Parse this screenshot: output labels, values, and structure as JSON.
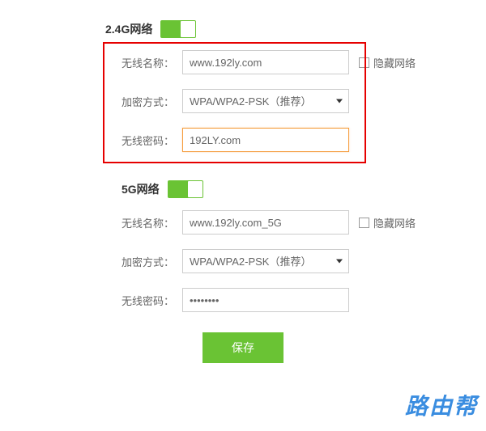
{
  "section24g": {
    "title": "2.4G网络",
    "name_label": "无线名称：",
    "name_value": "www.192ly.com",
    "hide_label": "隐藏网络",
    "encrypt_label": "加密方式：",
    "encrypt_value": "WPA/WPA2-PSK（推荐）",
    "password_label": "无线密码：",
    "password_value": "192LY.com"
  },
  "section5g": {
    "title": "5G网络",
    "name_label": "无线名称：",
    "name_value": "www.192ly.com_5G",
    "hide_label": "隐藏网络",
    "encrypt_label": "加密方式：",
    "encrypt_value": "WPA/WPA2-PSK（推荐）",
    "password_label": "无线密码：",
    "password_value": "••••••••"
  },
  "save_label": "保存",
  "watermark": "路由帮"
}
